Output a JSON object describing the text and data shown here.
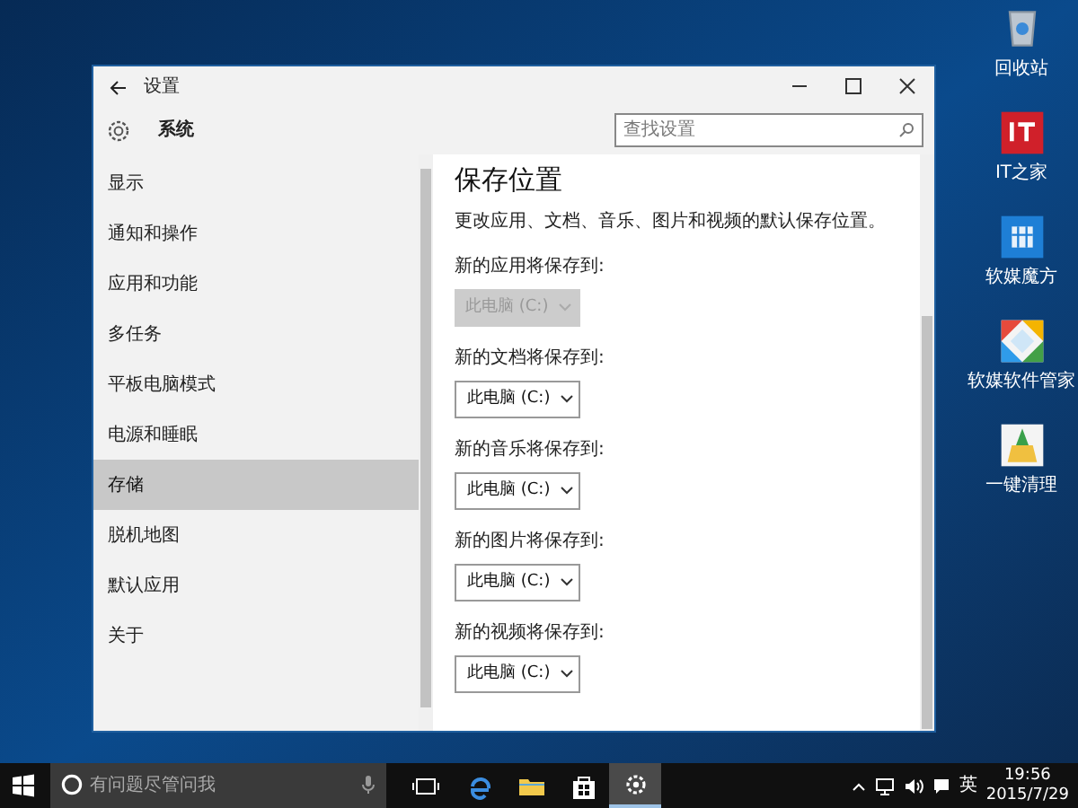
{
  "window": {
    "title": "设置",
    "section": "系统",
    "search": {
      "placeholder": "查找设置"
    }
  },
  "sidebar": {
    "items": [
      {
        "label": "显示",
        "selected": false
      },
      {
        "label": "通知和操作",
        "selected": false
      },
      {
        "label": "应用和功能",
        "selected": false
      },
      {
        "label": "多任务",
        "selected": false
      },
      {
        "label": "平板电脑模式",
        "selected": false
      },
      {
        "label": "电源和睡眠",
        "selected": false
      },
      {
        "label": "存储",
        "selected": true
      },
      {
        "label": "脱机地图",
        "selected": false
      },
      {
        "label": "默认应用",
        "selected": false
      },
      {
        "label": "关于",
        "selected": false
      }
    ]
  },
  "content": {
    "heading": "保存位置",
    "description": "更改应用、文档、音乐、图片和视频的默认保存位置。",
    "settings": [
      {
        "label": "新的应用将保存到:",
        "value": "此电脑 (C:)",
        "disabled": true
      },
      {
        "label": "新的文档将保存到:",
        "value": "此电脑 (C:)",
        "disabled": false
      },
      {
        "label": "新的音乐将保存到:",
        "value": "此电脑 (C:)",
        "disabled": false
      },
      {
        "label": "新的图片将保存到:",
        "value": "此电脑 (C:)",
        "disabled": false
      },
      {
        "label": "新的视频将保存到:",
        "value": "此电脑 (C:)",
        "disabled": false
      }
    ]
  },
  "desktop_icons": [
    {
      "label": "回收站",
      "kind": "bin"
    },
    {
      "label": "IT之家",
      "kind": "it"
    },
    {
      "label": "软媒魔方",
      "kind": "cube"
    },
    {
      "label": "软媒软件管家",
      "kind": "manager"
    },
    {
      "label": "一键清理",
      "kind": "broom"
    }
  ],
  "taskbar": {
    "search_placeholder": "有问题尽管问我",
    "apps": [
      {
        "kind": "taskview",
        "active": false
      },
      {
        "kind": "edge",
        "active": false
      },
      {
        "kind": "explorer",
        "active": false
      },
      {
        "kind": "store",
        "active": false
      },
      {
        "kind": "settings",
        "active": true
      }
    ],
    "input_method": "英",
    "time": "19:56",
    "date": "2015/7/29"
  }
}
